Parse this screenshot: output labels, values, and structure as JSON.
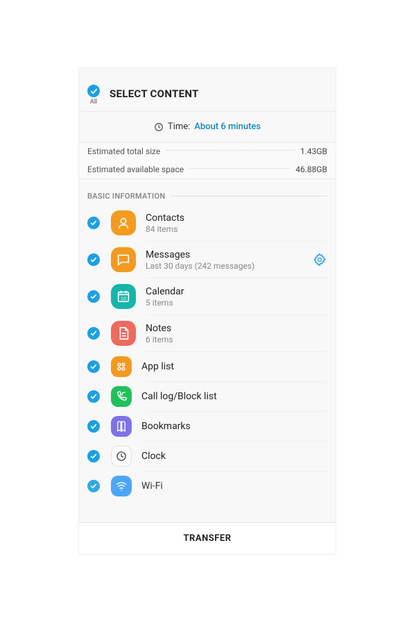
{
  "header": {
    "all_label": "All",
    "title": "SELECT CONTENT"
  },
  "time": {
    "label": "Time:",
    "value": "About 6 minutes"
  },
  "info": {
    "size_label": "Estimated total size",
    "size_value": "1.43GB",
    "space_label": "Estimated available space",
    "space_value": "46.88GB"
  },
  "section": {
    "basic_info": "BASIC INFORMATION"
  },
  "items": {
    "contacts": {
      "title": "Contacts",
      "sub": "84 items"
    },
    "messages": {
      "title": "Messages",
      "sub": "Last 30 days (242 messages)"
    },
    "calendar": {
      "title": "Calendar",
      "sub": "5 items"
    },
    "notes": {
      "title": "Notes",
      "sub": "6 items"
    },
    "applist": {
      "title": "App list"
    },
    "calllog": {
      "title": "Call log/Block list"
    },
    "bookmarks": {
      "title": "Bookmarks"
    },
    "clock": {
      "title": "Clock"
    },
    "wifi": {
      "title": "Wi-Fi"
    }
  },
  "footer": {
    "transfer": "TRANSFER"
  }
}
